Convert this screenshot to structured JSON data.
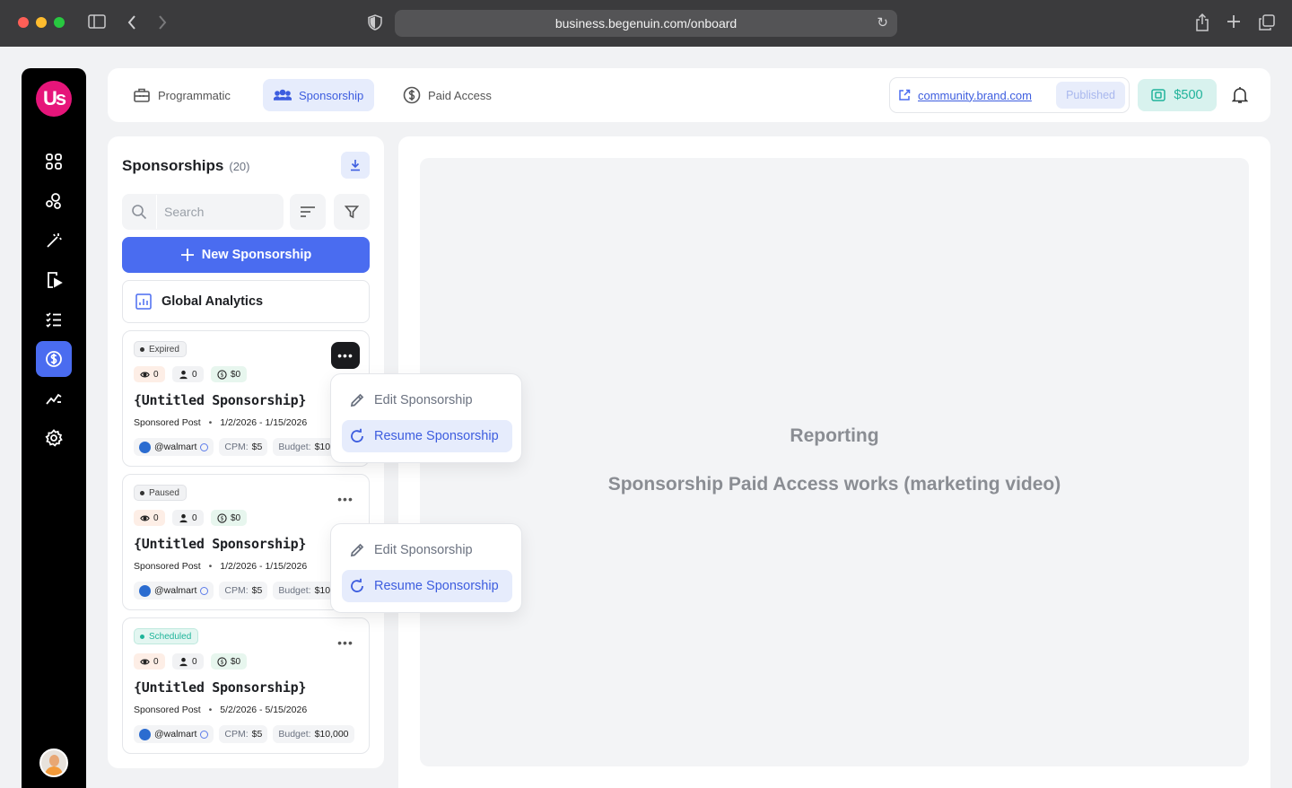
{
  "browser": {
    "url": "business.begenuin.com/onboard"
  },
  "sidebar": {
    "logo": "Us",
    "items": [
      {
        "icon": "grid-icon"
      },
      {
        "icon": "community-icon"
      },
      {
        "icon": "magic-wand-icon"
      },
      {
        "icon": "video-icon"
      },
      {
        "icon": "list-icon"
      },
      {
        "icon": "dollar-icon",
        "active": true
      },
      {
        "icon": "analytics-icon"
      },
      {
        "icon": "settings-icon"
      }
    ]
  },
  "topbar": {
    "tabs": [
      {
        "label": "Programmatic",
        "icon": "briefcase-icon"
      },
      {
        "label": "Sponsorship",
        "icon": "people-icon",
        "active": true
      },
      {
        "label": "Paid Access",
        "icon": "dollar-circle-icon"
      }
    ],
    "community_link": "community.brand.com",
    "published_label": "Published",
    "wallet_amount": "$500"
  },
  "panel": {
    "title": "Sponsorships",
    "count": "(20)",
    "search_placeholder": "Search",
    "new_button": "New Sponsorship",
    "analytics_button": "Global Analytics"
  },
  "cards": [
    {
      "status": "Expired",
      "views": "0",
      "users": "0",
      "spend": "$0",
      "title": "{Untitled Sponsorship}",
      "type": "Sponsored Post",
      "dates": "1/2/2026 - 1/15/2026",
      "handle": "@walmart",
      "cpm_label": "CPM:",
      "cpm_value": "$5",
      "budget_label": "Budget:",
      "budget_value": "$10,000"
    },
    {
      "status": "Paused",
      "views": "0",
      "users": "0",
      "spend": "$0",
      "title": "{Untitled Sponsorship}",
      "type": "Sponsored Post",
      "dates": "1/2/2026 - 1/15/2026",
      "handle": "@walmart",
      "cpm_label": "CPM:",
      "cpm_value": "$5",
      "budget_label": "Budget:",
      "budget_value": "$10,000"
    },
    {
      "status": "Scheduled",
      "views": "0",
      "users": "0",
      "spend": "$0",
      "title": "{Untitled Sponsorship}",
      "type": "Sponsored Post",
      "dates": "5/2/2026 - 5/15/2026",
      "handle": "@walmart",
      "cpm_label": "CPM:",
      "cpm_value": "$5",
      "budget_label": "Budget:",
      "budget_value": "$10,000"
    }
  ],
  "menus": [
    {
      "edit": "Edit Sponsorship",
      "resume": "Resume Sponsorship"
    },
    {
      "edit": "Edit Sponsorship",
      "resume": "Resume Sponsorship"
    }
  ],
  "main": {
    "heading": "Reporting",
    "subheading": "Sponsorship Paid Access works (marketing video)"
  },
  "colors": {
    "accent": "#4a6cf0",
    "active_tab_bg": "#e6ecfc",
    "wallet_bg": "#d8f2ee",
    "wallet_text": "#21b39b",
    "expired": "#555555",
    "scheduled": "#1fb49a"
  }
}
